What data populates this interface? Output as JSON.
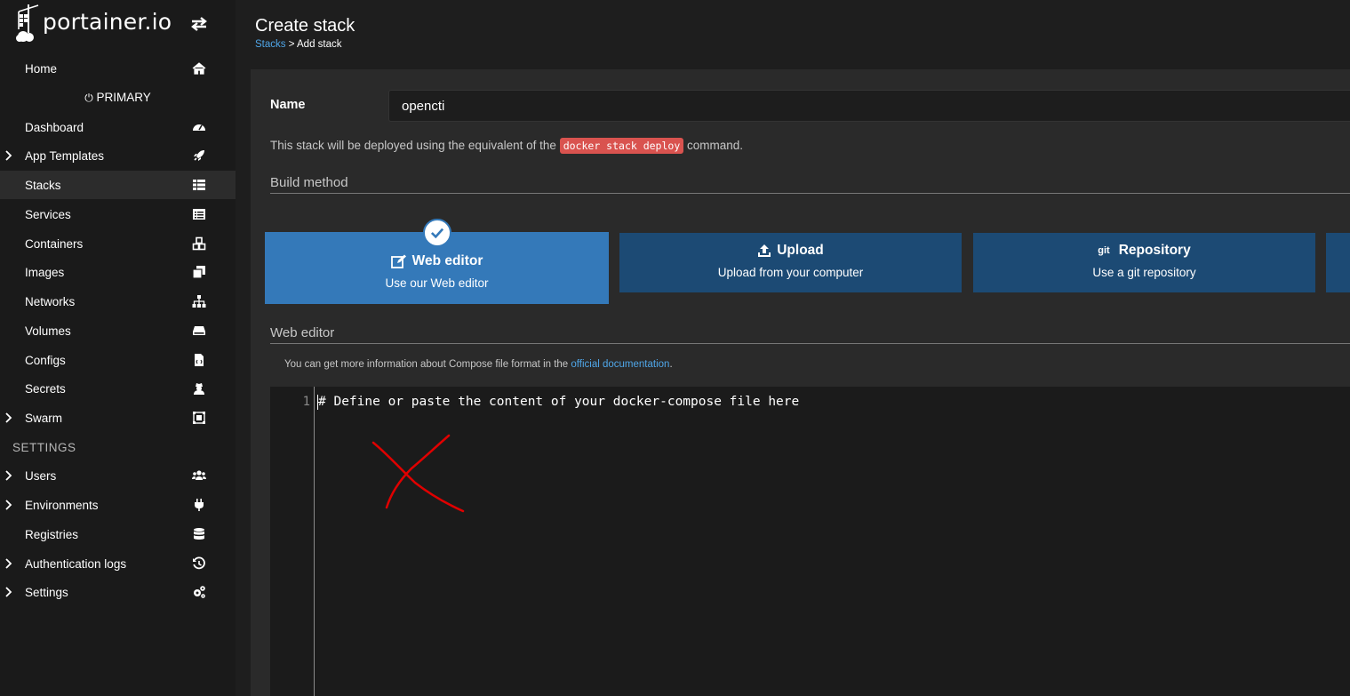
{
  "brand": {
    "logo_text": "portainer.io"
  },
  "sidebar": {
    "home": "Home",
    "environment_header": "PRIMARY",
    "items": [
      {
        "label": "Dashboard",
        "icon": "tachometer-icon",
        "expandable": false,
        "active": false
      },
      {
        "label": "App Templates",
        "icon": "rocket-icon",
        "expandable": true,
        "active": false
      },
      {
        "label": "Stacks",
        "icon": "th-list-icon",
        "expandable": false,
        "active": true
      },
      {
        "label": "Services",
        "icon": "list-alt-icon",
        "expandable": false,
        "active": false
      },
      {
        "label": "Containers",
        "icon": "cubes-icon",
        "expandable": false,
        "active": false
      },
      {
        "label": "Images",
        "icon": "clone-icon",
        "expandable": false,
        "active": false
      },
      {
        "label": "Networks",
        "icon": "sitemap-icon",
        "expandable": false,
        "active": false
      },
      {
        "label": "Volumes",
        "icon": "hdd-icon",
        "expandable": false,
        "active": false
      },
      {
        "label": "Configs",
        "icon": "file-code-icon",
        "expandable": false,
        "active": false
      },
      {
        "label": "Secrets",
        "icon": "user-secret-icon",
        "expandable": false,
        "active": false
      },
      {
        "label": "Swarm",
        "icon": "object-group-icon",
        "expandable": true,
        "active": false
      }
    ],
    "settings_header": "SETTINGS",
    "settings_items": [
      {
        "label": "Users",
        "icon": "users-icon",
        "expandable": true
      },
      {
        "label": "Environments",
        "icon": "plug-icon",
        "expandable": true
      },
      {
        "label": "Registries",
        "icon": "database-icon",
        "expandable": false
      },
      {
        "label": "Authentication logs",
        "icon": "history-icon",
        "expandable": true
      },
      {
        "label": "Settings",
        "icon": "cogs-icon",
        "expandable": true
      }
    ]
  },
  "header": {
    "title": "Create stack",
    "breadcrumb_link": "Stacks",
    "breadcrumb_sep": " > ",
    "breadcrumb_current": "Add stack"
  },
  "form": {
    "name_label": "Name",
    "name_value": "opencti",
    "deploy_note_before": "This stack will be deployed using the equivalent of the ",
    "deploy_code": "docker stack deploy",
    "deploy_note_after": " command.",
    "build_method_title": "Build method",
    "build_methods": {
      "web": {
        "title": "Web editor",
        "subtitle": "Use our Web editor",
        "selected": true
      },
      "upload": {
        "title": "Upload",
        "subtitle": "Upload from your computer"
      },
      "git": {
        "title": "Repository",
        "subtitle": "Use a git repository",
        "prefix": "git"
      }
    },
    "web_editor_title": "Web editor",
    "compose_note_before": "You can get more information about Compose file format in the ",
    "compose_note_link": "official documentation",
    "compose_note_after": ".",
    "editor": {
      "line_number": "1",
      "line_text": "# Define or paste the content of your docker-compose file here"
    }
  },
  "colors": {
    "accent": "#3479b9",
    "method_box": "#1c4a74",
    "link": "#4fa6e8",
    "code_badge": "#d9534f",
    "annotation": "#e00000"
  }
}
